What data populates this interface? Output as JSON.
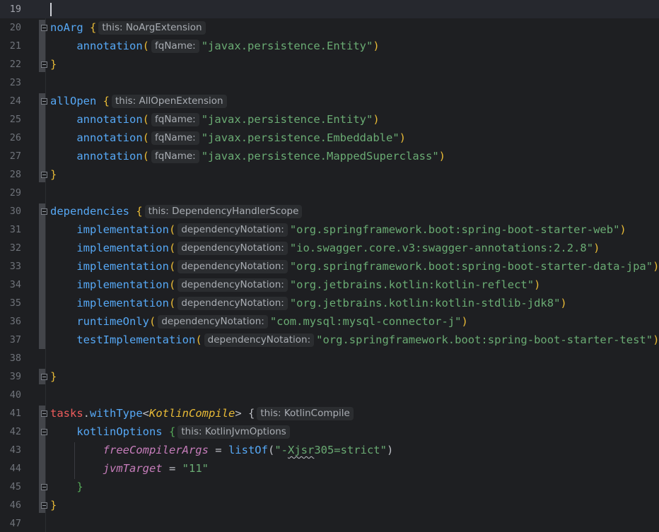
{
  "editor": {
    "lines": [
      {
        "n": "19",
        "tokens": []
      },
      {
        "n": "20",
        "tokens": [
          {
            "t": "noArg",
            "c": "fn"
          },
          {
            "t": " "
          },
          {
            "t": "{",
            "c": "br"
          },
          {
            "h": "this: NoArgExtension"
          }
        ]
      },
      {
        "n": "21",
        "tokens": [
          {
            "t": "    "
          },
          {
            "t": "annotation",
            "c": "fn"
          },
          {
            "t": "(",
            "c": "br"
          },
          {
            "h": "fqName:"
          },
          {
            "t": "\"javax.persistence.Entity\"",
            "c": "str"
          },
          {
            "t": ")",
            "c": "br"
          }
        ]
      },
      {
        "n": "22",
        "tokens": [
          {
            "t": "}",
            "c": "br"
          }
        ]
      },
      {
        "n": "23",
        "tokens": []
      },
      {
        "n": "24",
        "tokens": [
          {
            "t": "allOpen",
            "c": "fn"
          },
          {
            "t": " "
          },
          {
            "t": "{",
            "c": "br"
          },
          {
            "h": "this: AllOpenExtension"
          }
        ]
      },
      {
        "n": "25",
        "tokens": [
          {
            "t": "    "
          },
          {
            "t": "annotation",
            "c": "fn"
          },
          {
            "t": "(",
            "c": "br"
          },
          {
            "h": "fqName:"
          },
          {
            "t": "\"javax.persistence.Entity\"",
            "c": "str"
          },
          {
            "t": ")",
            "c": "br"
          }
        ]
      },
      {
        "n": "26",
        "tokens": [
          {
            "t": "    "
          },
          {
            "t": "annotation",
            "c": "fn"
          },
          {
            "t": "(",
            "c": "br"
          },
          {
            "h": "fqName:"
          },
          {
            "t": "\"javax.persistence.Embeddable\"",
            "c": "str"
          },
          {
            "t": ")",
            "c": "br"
          }
        ]
      },
      {
        "n": "27",
        "tokens": [
          {
            "t": "    "
          },
          {
            "t": "annotation",
            "c": "fn"
          },
          {
            "t": "(",
            "c": "br"
          },
          {
            "h": "fqName:"
          },
          {
            "t": "\"javax.persistence.MappedSuperclass\"",
            "c": "str"
          },
          {
            "t": ")",
            "c": "br"
          }
        ]
      },
      {
        "n": "28",
        "tokens": [
          {
            "t": "}",
            "c": "br"
          }
        ]
      },
      {
        "n": "29",
        "tokens": []
      },
      {
        "n": "30",
        "tokens": [
          {
            "t": "dependencies",
            "c": "fn"
          },
          {
            "t": " "
          },
          {
            "t": "{",
            "c": "br"
          },
          {
            "h": "this: DependencyHandlerScope"
          }
        ]
      },
      {
        "n": "31",
        "tokens": [
          {
            "t": "    "
          },
          {
            "t": "implementation",
            "c": "fn"
          },
          {
            "t": "(",
            "c": "br"
          },
          {
            "h": "dependencyNotation:"
          },
          {
            "t": "\"org.springframework.boot:spring-boot-starter-web\"",
            "c": "str"
          },
          {
            "t": ")",
            "c": "br"
          }
        ]
      },
      {
        "n": "32",
        "tokens": [
          {
            "t": "    "
          },
          {
            "t": "implementation",
            "c": "fn"
          },
          {
            "t": "(",
            "c": "br"
          },
          {
            "h": "dependencyNotation:"
          },
          {
            "t": "\"io.swagger.core.v3:swagger-annotations:2.2.8\"",
            "c": "str"
          },
          {
            "t": ")",
            "c": "br"
          }
        ]
      },
      {
        "n": "33",
        "tokens": [
          {
            "t": "    "
          },
          {
            "t": "implementation",
            "c": "fn"
          },
          {
            "t": "(",
            "c": "br"
          },
          {
            "h": "dependencyNotation:"
          },
          {
            "t": "\"org.springframework.boot:spring-boot-starter-data-jpa\"",
            "c": "str"
          },
          {
            "t": ")",
            "c": "br"
          }
        ]
      },
      {
        "n": "34",
        "tokens": [
          {
            "t": "    "
          },
          {
            "t": "implementation",
            "c": "fn"
          },
          {
            "t": "(",
            "c": "br"
          },
          {
            "h": "dependencyNotation:"
          },
          {
            "t": "\"org.jetbrains.kotlin:kotlin-reflect\"",
            "c": "str"
          },
          {
            "t": ")",
            "c": "br"
          }
        ]
      },
      {
        "n": "35",
        "tokens": [
          {
            "t": "    "
          },
          {
            "t": "implementation",
            "c": "fn"
          },
          {
            "t": "(",
            "c": "br"
          },
          {
            "h": "dependencyNotation:"
          },
          {
            "t": "\"org.jetbrains.kotlin:kotlin-stdlib-jdk8\"",
            "c": "str"
          },
          {
            "t": ")",
            "c": "br"
          }
        ]
      },
      {
        "n": "36",
        "tokens": [
          {
            "t": "    "
          },
          {
            "t": "runtimeOnly",
            "c": "fn"
          },
          {
            "t": "(",
            "c": "br"
          },
          {
            "h": "dependencyNotation:"
          },
          {
            "t": "\"com.mysql:mysql-connector-j\"",
            "c": "str"
          },
          {
            "t": ")",
            "c": "br"
          }
        ]
      },
      {
        "n": "37",
        "tokens": [
          {
            "t": "    "
          },
          {
            "t": "testImplementation",
            "c": "fn"
          },
          {
            "t": "(",
            "c": "br"
          },
          {
            "h": "dependencyNotation:"
          },
          {
            "t": "\"org.springframework.boot:spring-boot-starter-test\"",
            "c": "str"
          },
          {
            "t": ")",
            "c": "br"
          }
        ]
      },
      {
        "n": "38",
        "tokens": []
      },
      {
        "n": "39",
        "tokens": [
          {
            "t": "}",
            "c": "br"
          }
        ]
      },
      {
        "n": "40",
        "tokens": []
      },
      {
        "n": "41",
        "tokens": [
          {
            "t": "tasks",
            "c": "red"
          },
          {
            "t": ".",
            "c": "plain"
          },
          {
            "t": "withType",
            "c": "fn"
          },
          {
            "t": "<",
            "c": "plain"
          },
          {
            "t": "KotlinCompile",
            "c": "type"
          },
          {
            "t": ">",
            "c": "plain"
          },
          {
            "t": " "
          },
          {
            "t": "{",
            "c": "plain"
          },
          {
            "h": "this: KotlinCompile"
          }
        ]
      },
      {
        "n": "42",
        "tokens": [
          {
            "t": "    "
          },
          {
            "t": "kotlinOptions",
            "c": "fn"
          },
          {
            "t": " "
          },
          {
            "t": "{",
            "c": "br2"
          },
          {
            "h": "this: KotlinJvmOptions"
          }
        ]
      },
      {
        "n": "43",
        "tokens": [
          {
            "t": "        "
          },
          {
            "t": "freeCompilerArgs",
            "c": "prop"
          },
          {
            "t": " = ",
            "c": "plain"
          },
          {
            "t": "listOf",
            "c": "fn"
          },
          {
            "t": "(",
            "c": "plain"
          },
          {
            "t": "\"-",
            "c": "str"
          },
          {
            "t": "Xjsr",
            "c": "str",
            "sq": true
          },
          {
            "t": "305=strict\"",
            "c": "str"
          },
          {
            "t": ")",
            "c": "plain"
          }
        ]
      },
      {
        "n": "44",
        "tokens": [
          {
            "t": "        "
          },
          {
            "t": "jvmTarget",
            "c": "prop"
          },
          {
            "t": " = ",
            "c": "plain"
          },
          {
            "t": "\"11\"",
            "c": "str"
          }
        ]
      },
      {
        "n": "45",
        "tokens": [
          {
            "t": "    "
          },
          {
            "t": "}",
            "c": "br2"
          }
        ]
      },
      {
        "n": "46",
        "tokens": [
          {
            "t": "}",
            "c": "br"
          }
        ]
      },
      {
        "n": "47",
        "tokens": []
      }
    ]
  },
  "colors": {
    "background": "#1e1f22",
    "function": "#56a8f5",
    "string": "#6aab73",
    "brace": "#e8ba36",
    "inner_brace": "#54a857",
    "receiver": "#ee5c5c",
    "type_param": "#e8ba36",
    "property": "#c77dbb",
    "inlay_hint_bg": "#2b2d30",
    "change_marker": "#5fb865"
  }
}
